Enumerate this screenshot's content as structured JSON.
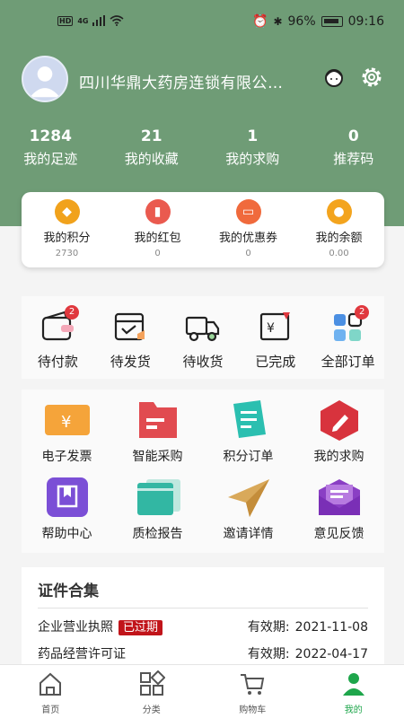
{
  "status_bar": {
    "time": "09:16",
    "battery": "96%",
    "network": "4G"
  },
  "header": {
    "company": "四川华鼎大药房连锁有限公…",
    "stats": [
      {
        "value": "1284",
        "label": "我的足迹"
      },
      {
        "value": "21",
        "label": "我的收藏"
      },
      {
        "value": "1",
        "label": "我的求购"
      },
      {
        "value": "0",
        "label": "推荐码"
      }
    ]
  },
  "wallet": [
    {
      "label": "我的积分",
      "value": "2730",
      "icon": "diamond-icon",
      "color": "#f1a21c"
    },
    {
      "label": "我的红包",
      "value": "0",
      "icon": "red-packet-icon",
      "color": "#ea5a4f"
    },
    {
      "label": "我的优惠券",
      "value": "0",
      "icon": "coupon-icon",
      "color": "#f06a3c"
    },
    {
      "label": "我的余额",
      "value": "0.00",
      "icon": "coins-icon",
      "color": "#f3a41e"
    }
  ],
  "orders": [
    {
      "label": "待付款",
      "badge": "2",
      "icon": "wallet-icon"
    },
    {
      "label": "待发货",
      "badge": "",
      "icon": "box-check-icon"
    },
    {
      "label": "待收货",
      "badge": "",
      "icon": "truck-icon"
    },
    {
      "label": "已完成",
      "badge": "",
      "icon": "receipt-icon"
    },
    {
      "label": "全部订单",
      "badge": "2",
      "icon": "grid-icon"
    }
  ],
  "tools": [
    {
      "label": "电子发票",
      "icon": "invoice-icon"
    },
    {
      "label": "智能采购",
      "icon": "folder-icon"
    },
    {
      "label": "积分订单",
      "icon": "clipboard-icon"
    },
    {
      "label": "我的求购",
      "icon": "edit-icon"
    },
    {
      "label": "帮助中心",
      "icon": "book-icon"
    },
    {
      "label": "质检报告",
      "icon": "report-icon"
    },
    {
      "label": "邀请详情",
      "icon": "paper-plane-icon"
    },
    {
      "label": "意见反馈",
      "icon": "mail-icon"
    }
  ],
  "certs": {
    "title": "证件合集",
    "items": [
      {
        "name": "企业营业执照",
        "tag": "已过期",
        "validity_label": "有效期:",
        "date": "2021-11-08"
      },
      {
        "name": "药品经营许可证",
        "tag": "",
        "validity_label": "有效期:",
        "date": "2022-04-17"
      }
    ]
  },
  "tabbar": [
    {
      "label": "首页",
      "icon": "home-icon"
    },
    {
      "label": "分类",
      "icon": "category-icon"
    },
    {
      "label": "购物车",
      "icon": "cart-icon"
    },
    {
      "label": "我的",
      "icon": "user-icon",
      "active": true
    }
  ],
  "colors": {
    "header_bg": "#6f9c76",
    "accent_green": "#1ea64b",
    "badge_red": "#e0383e"
  }
}
